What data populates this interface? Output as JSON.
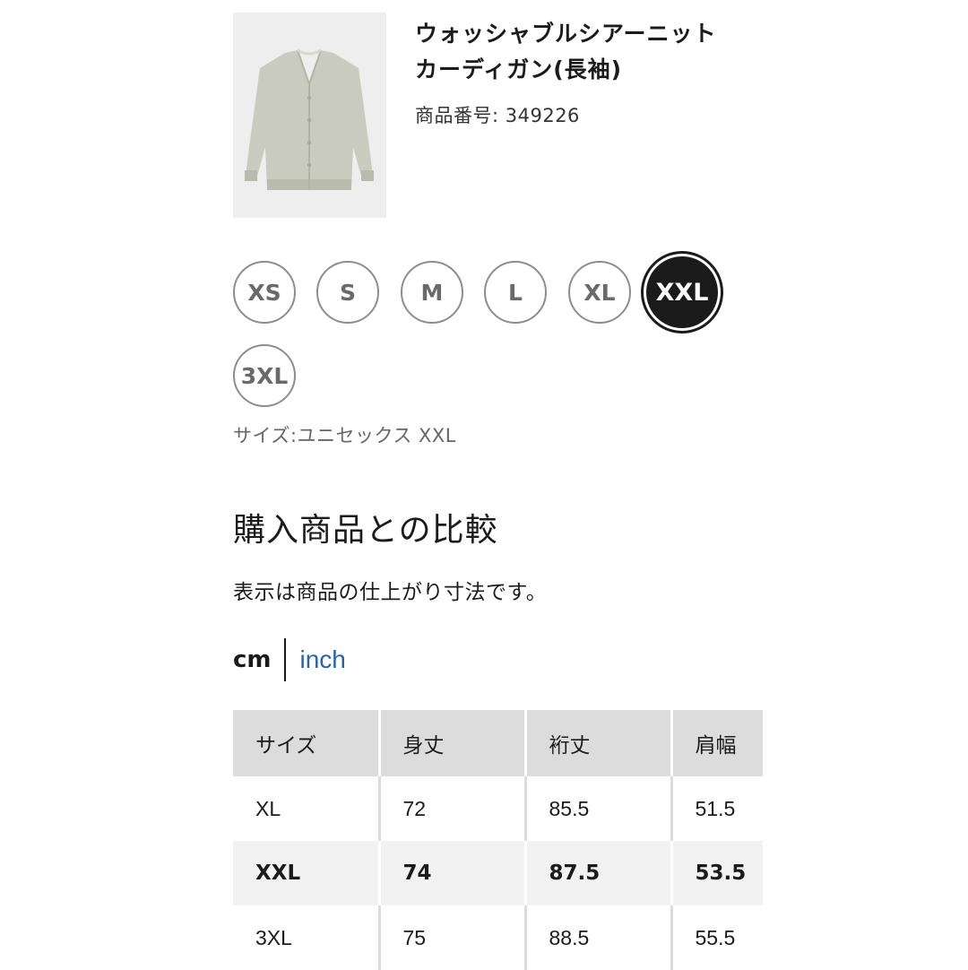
{
  "product": {
    "name": "ウォッシャブルシアーニットカーディガン(長袖)",
    "number": "商品番号: 349226",
    "image_color": "#c8cbbd"
  },
  "sizes": [
    "XS",
    "S",
    "M",
    "L",
    "XL",
    "XXL",
    "3XL"
  ],
  "selected_size_index": 5,
  "selected_size_text": "サイズ:ユニセックス XXL",
  "comparison": {
    "title": "購入商品との比較",
    "note": "表示は商品の仕上がり寸法です。",
    "unit_cm": "cm",
    "unit_inch": "inch",
    "columns": [
      "サイズ",
      "身丈",
      "裄丈",
      "肩幅"
    ],
    "rows": [
      [
        "XL",
        "72",
        "85.5",
        "51.5"
      ],
      [
        "XXL",
        "74",
        "87.5",
        "53.5"
      ],
      [
        "3XL",
        "75",
        "88.5",
        "55.5"
      ]
    ],
    "highlight_row_index": 1
  },
  "colors": {
    "accent_link": "#2a63a8",
    "selected": "#1b1b1b",
    "header_bg": "#dcdcdc"
  }
}
